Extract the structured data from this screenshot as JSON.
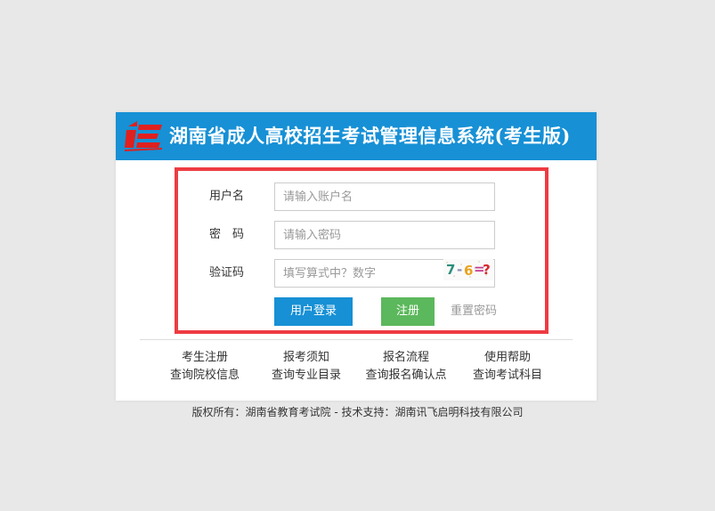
{
  "header": {
    "title": "湖南省成人高校招生考试管理信息系统(考生版)",
    "logo_icon": "hunan-exam-logo-icon"
  },
  "form": {
    "username_label": "用户名",
    "username_placeholder": "请输入账户名",
    "password_label": "密　码",
    "password_placeholder": "请输入密码",
    "captcha_label": "验证码",
    "captcha_placeholder": "填写算式中？数字",
    "captcha_image_text": "7-6=?",
    "login_button": "用户登录",
    "register_button": "注册",
    "reset_password_link": "重置密码"
  },
  "quick_links": [
    {
      "label": "考生注册"
    },
    {
      "label": "报考须知"
    },
    {
      "label": "报名流程"
    },
    {
      "label": "使用帮助"
    },
    {
      "label": "查询院校信息"
    },
    {
      "label": "查询专业目录"
    },
    {
      "label": "查询报名确认点"
    },
    {
      "label": "查询考试科目"
    }
  ],
  "footer": {
    "text": "版权所有：湖南省教育考试院 - 技术支持：湖南讯飞启明科技有限公司"
  },
  "colors": {
    "header_bg": "#1790d5",
    "highlight_border": "#ee3b42",
    "login_button": "#1790d5",
    "register_button": "#5cb85c",
    "page_bg": "#e8e8e8"
  }
}
